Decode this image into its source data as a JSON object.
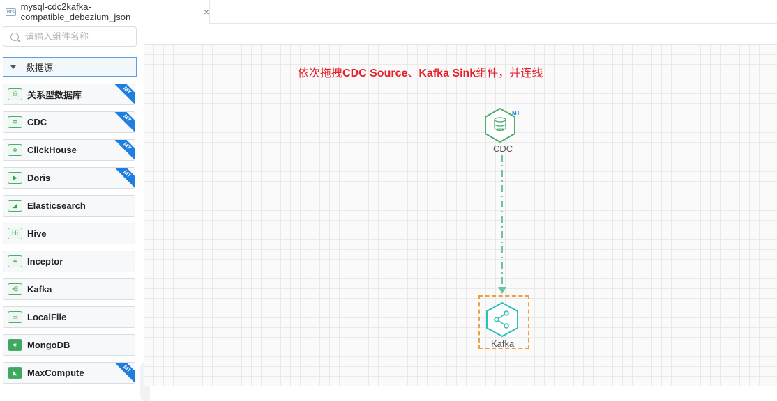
{
  "tab": {
    "icon_text": "Rts",
    "title": "mysql-cdc2kafka-compatible_debezium_json",
    "close": "×"
  },
  "sidebar": {
    "search_placeholder": "请输入组件名称",
    "group_label": "数据源",
    "items": [
      {
        "label": "关系型数据库",
        "icon": "relational-db-icon",
        "badge": "MT"
      },
      {
        "label": "CDC",
        "icon": "cdc-icon",
        "badge": "MT"
      },
      {
        "label": "ClickHouse",
        "icon": "clickhouse-icon",
        "badge": "MT"
      },
      {
        "label": "Doris",
        "icon": "doris-icon",
        "badge": "MT"
      },
      {
        "label": "Elasticsearch",
        "icon": "elasticsearch-icon",
        "badge": ""
      },
      {
        "label": "Hive",
        "icon": "hive-icon",
        "badge": ""
      },
      {
        "label": "Inceptor",
        "icon": "inceptor-icon",
        "badge": ""
      },
      {
        "label": "Kafka",
        "icon": "kafka-icon",
        "badge": ""
      },
      {
        "label": "LocalFile",
        "icon": "folder-icon",
        "badge": ""
      },
      {
        "label": "MongoDB",
        "icon": "mongodb-icon",
        "badge": ""
      },
      {
        "label": "MaxCompute",
        "icon": "maxcompute-icon",
        "badge": "MT"
      }
    ]
  },
  "canvas": {
    "hint_prefix": "依次拖拽",
    "hint_b1": "CDC Source",
    "hint_sep": "、",
    "hint_b2": "Kafka Sink",
    "hint_suffix": "组件，并连线",
    "nodes": {
      "cdc": {
        "label": "CDC",
        "badge": "MT",
        "icon_text": "CDC"
      },
      "kafka": {
        "label": "Kafka"
      }
    }
  },
  "colors": {
    "accent_blue": "#1e7fe0",
    "node_green": "#4cae6a",
    "node_teal": "#2bbfc0",
    "hint_red": "#e8202a",
    "edge": "#6cc4a0",
    "selection": "#f0a040"
  }
}
